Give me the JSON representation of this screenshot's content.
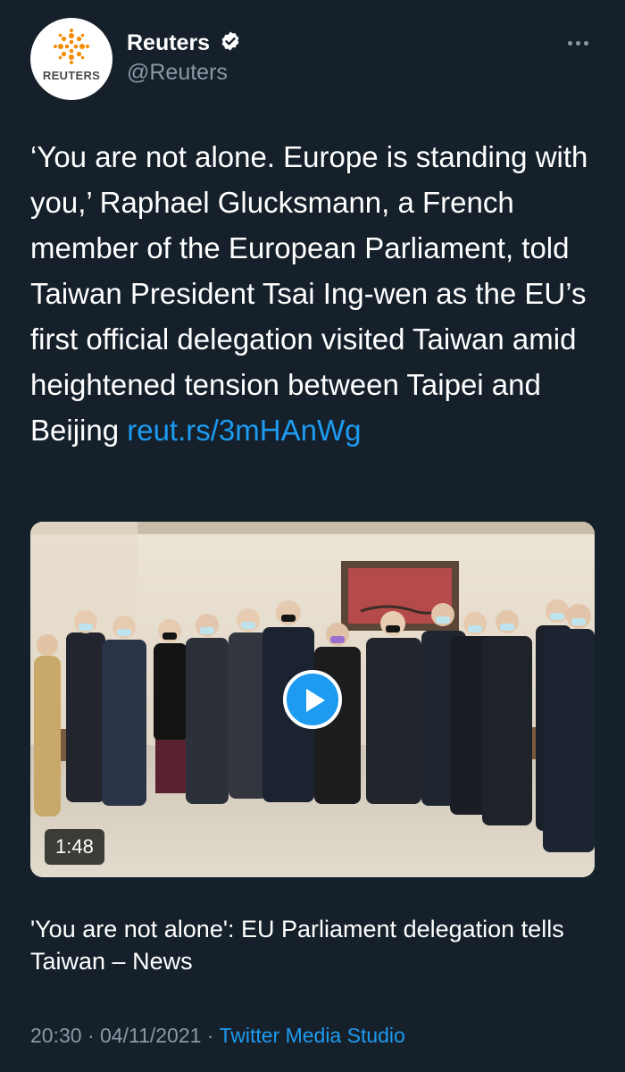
{
  "author": {
    "display_name": "Reuters",
    "handle": "@Reuters",
    "avatar_text": "REUTERS",
    "verified": true
  },
  "tweet": {
    "text": "‘You are not alone. Europe is standing with you,’ Raphael Glucksmann, a French member of the European Parliament, told Taiwan President Tsai Ing-wen as the EU’s first official delegation visited Taiwan amid heightened tension between Taipei and Beijing ",
    "link": "reut.rs/3mHAnWg"
  },
  "media": {
    "duration": "1:48",
    "card_title": "'You are not alone': EU Parliament delegation tells Taiwan – News"
  },
  "meta": {
    "time": "20:30",
    "separator_1": " · ",
    "date": "04/11/2021",
    "separator_2": " · ",
    "source": "Twitter Media Studio"
  },
  "colors": {
    "background": "#15202b",
    "accent": "#1d9bf0",
    "muted": "#8b98a5"
  },
  "icons": {
    "verified": "verified-badge-icon",
    "more": "more-horizontal-icon",
    "play": "play-icon"
  }
}
